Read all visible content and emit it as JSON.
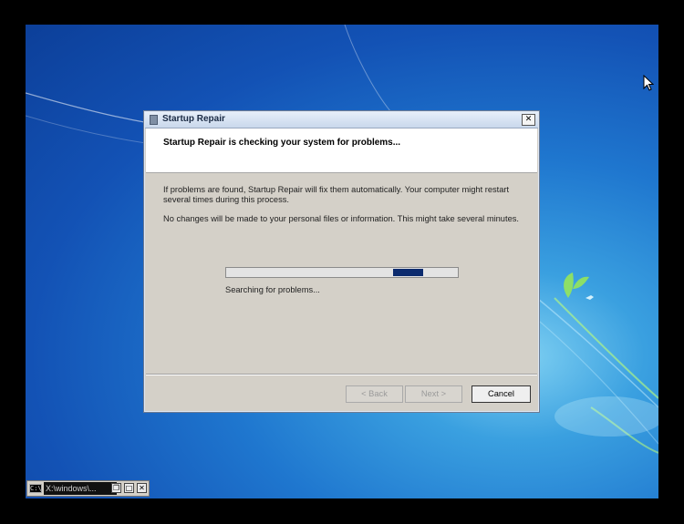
{
  "window": {
    "title": "Startup Repair",
    "close_glyph": "✕",
    "icon": "startup-repair-icon"
  },
  "header": {
    "title": "Startup Repair is checking your system for problems..."
  },
  "body": {
    "paragraph1": "If problems are found, Startup Repair will fix them automatically. Your computer might restart several times during this process.",
    "paragraph2": "No changes will be made to your personal files or information. This might take several minutes.",
    "status": "Searching for problems..."
  },
  "progress": {
    "indeterminate": true,
    "chunk_start": 0.72,
    "chunk_end": 0.85
  },
  "buttons": {
    "back": "< Back",
    "next": "Next >",
    "cancel": "Cancel"
  },
  "console": {
    "icon_text": "C:\\",
    "title": "X:\\windows\\...",
    "restore_glyph": "❐",
    "maximize_glyph": "□",
    "close_glyph": "✕"
  },
  "colors": {
    "progress_chunk": "#0c2b6e",
    "dialog_bg": "#d4d0c8",
    "desktop_blue": "#1352b5"
  }
}
